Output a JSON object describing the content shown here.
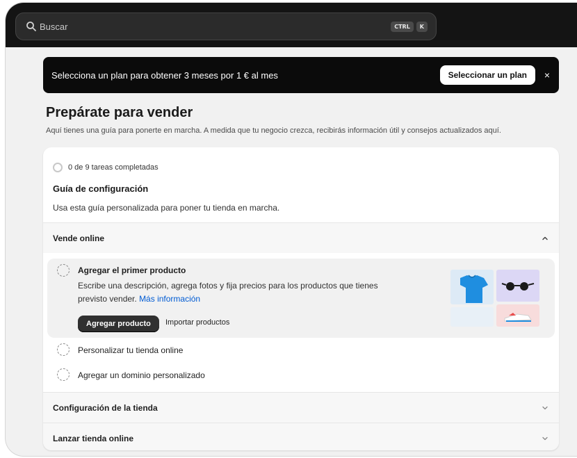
{
  "search": {
    "placeholder": "Buscar",
    "shortcut_keys": [
      "CTRL",
      "K"
    ]
  },
  "banner": {
    "text": "Selecciona un plan para obtener 3 meses por 1 € al mes",
    "button_label": "Seleccionar un plan",
    "close_icon": "×"
  },
  "page": {
    "title": "Prepárate para vender",
    "subtitle": "Aquí tienes una guía para ponerte en marcha. A medida que tu negocio crezca, recibirás información útil y consejos actualizados aquí."
  },
  "guide": {
    "progress_text": "0 de 9 tareas completadas",
    "title": "Guía de configuración",
    "description": "Usa esta guía personalizada para poner tu tienda en marcha."
  },
  "sections": [
    {
      "label": "Vende online",
      "expanded": true
    },
    {
      "label": "Configuración de la tienda",
      "expanded": false
    },
    {
      "label": "Lanzar tienda online",
      "expanded": false
    }
  ],
  "active_task": {
    "title": "Agregar el primer producto",
    "description": "Escribe una descripción, agrega fotos y fija precios para los productos que tienes previsto vender.",
    "link_label": "Más información",
    "primary_button": "Agregar producto",
    "secondary_button": "Importar productos"
  },
  "tasks": [
    {
      "label": "Personalizar tu tienda online"
    },
    {
      "label": "Agregar un dominio personalizado"
    }
  ],
  "colors": {
    "topbar": "#141414",
    "banner": "#0b0b0b",
    "link": "#005bd3",
    "primary_button": "#303030",
    "background": "#f1f1f1"
  }
}
